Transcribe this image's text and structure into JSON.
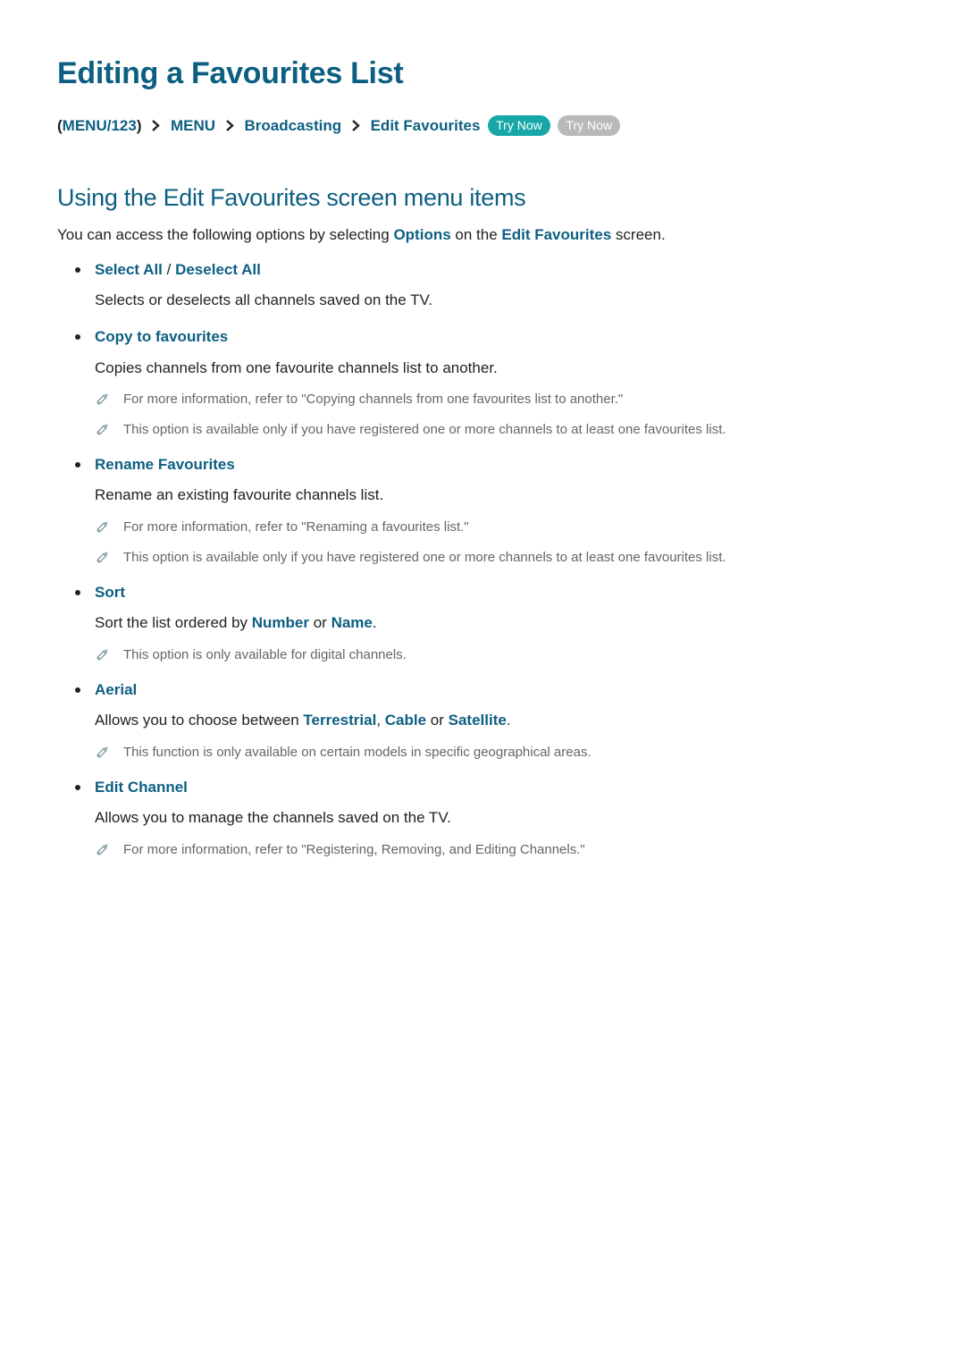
{
  "title": "Editing a Favourites List",
  "breadcrumb": {
    "p1": "MENU/123",
    "p2": "MENU",
    "p3": "Broadcasting",
    "p4": "Edit Favourites",
    "pill1": "Try Now",
    "pill2": "Try Now"
  },
  "subtitle": "Using the Edit Favourites screen menu items",
  "intro": {
    "pre": "You can access the following options by selecting ",
    "hl1": "Options",
    "mid": " on the ",
    "hl2": "Edit Favourites",
    "post": " screen."
  },
  "options": [
    {
      "title_a": "Select All",
      "title_sep": " / ",
      "title_b": "Deselect All",
      "desc": [
        {
          "t": "Selects or deselects all channels saved on the TV."
        }
      ],
      "notes": []
    },
    {
      "title_a": "Copy to favourites",
      "desc": [
        {
          "t": "Copies channels from one favourite channels list to another."
        }
      ],
      "notes": [
        {
          "t": "For more information, refer to \"Copying channels from one favourites list to another.\""
        },
        {
          "t": "This option is available only if you have registered one or more channels to at least one favourites list."
        }
      ]
    },
    {
      "title_a": "Rename Favourites",
      "desc": [
        {
          "t": "Rename an existing favourite channels list."
        }
      ],
      "notes": [
        {
          "t": "For more information, refer to \"Renaming a favourites list.\""
        },
        {
          "t": "This option is available only if you have registered one or more channels to at least one favourites list."
        }
      ]
    },
    {
      "title_a": "Sort",
      "desc": [
        {
          "t": "Sort the list ordered by "
        },
        {
          "t": "Number",
          "hl": true
        },
        {
          "t": " or "
        },
        {
          "t": "Name",
          "hl": true
        },
        {
          "t": "."
        }
      ],
      "notes": [
        {
          "t": "This option is only available for digital channels."
        }
      ]
    },
    {
      "title_a": "Aerial",
      "desc": [
        {
          "t": "Allows you to choose between "
        },
        {
          "t": "Terrestrial",
          "hl": true
        },
        {
          "t": ", "
        },
        {
          "t": "Cable",
          "hl": true
        },
        {
          "t": " or "
        },
        {
          "t": "Satellite",
          "hl": true
        },
        {
          "t": "."
        }
      ],
      "notes": [
        {
          "t": "This function is only available on certain models in specific geographical areas."
        }
      ]
    },
    {
      "title_a": "Edit Channel",
      "desc": [
        {
          "t": "Allows you to manage the channels saved on the TV."
        }
      ],
      "notes": [
        {
          "t": "For more information, refer to \"Registering, Removing, and Editing Channels.\""
        }
      ]
    }
  ]
}
